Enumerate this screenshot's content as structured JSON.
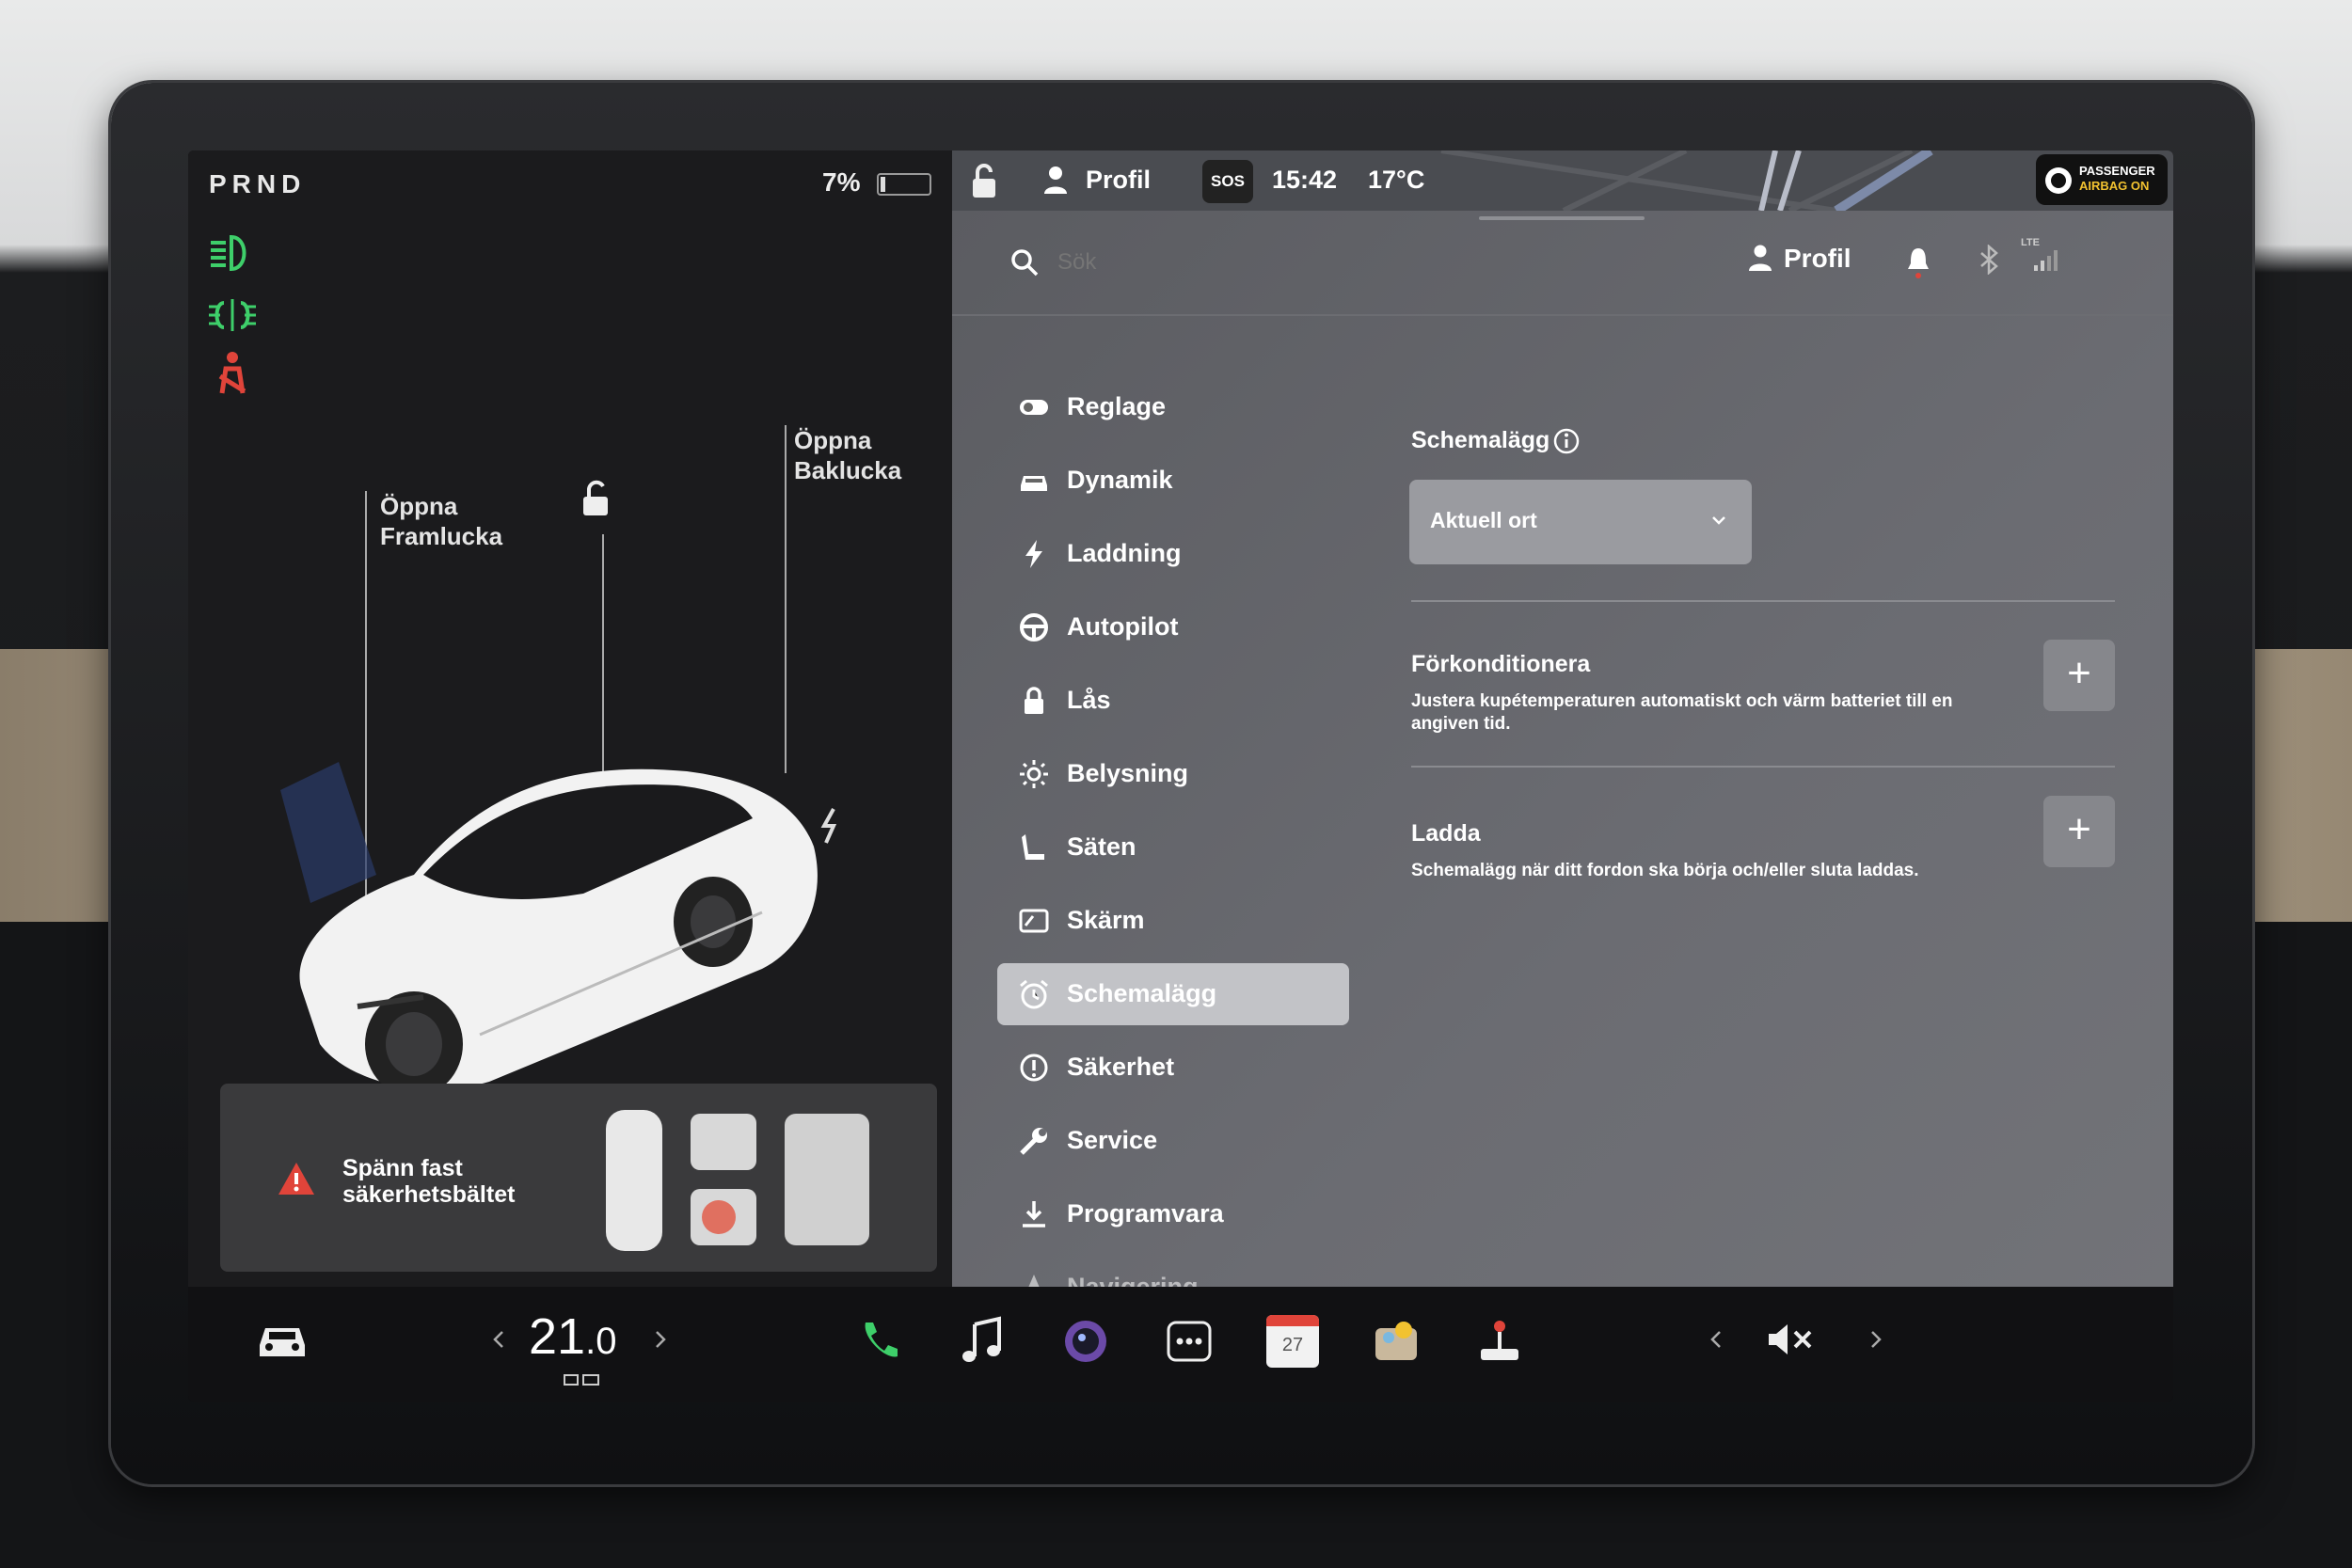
{
  "status": {
    "gear": "PRND",
    "battery": "7%",
    "time": "15:42",
    "temperature": "17°C",
    "profile": "Profil",
    "sos": "SOS",
    "airbag_line1": "PASSENGER",
    "airbag_line2": "AIRBAG ON"
  },
  "car": {
    "front_trunk_line1": "Öppna",
    "front_trunk_line2": "Framlucka",
    "rear_trunk_line1": "Öppna",
    "rear_trunk_line2": "Baklucka",
    "warning_line1": "Spänn fast",
    "warning_line2": "säkerhetsbältet"
  },
  "search": {
    "placeholder": "Sök",
    "profile": "Profil",
    "network": "LTE"
  },
  "nav": {
    "items": [
      {
        "label": "Reglage",
        "icon": "toggle-icon"
      },
      {
        "label": "Dynamik",
        "icon": "car-icon"
      },
      {
        "label": "Laddning",
        "icon": "bolt-icon"
      },
      {
        "label": "Autopilot",
        "icon": "steering-wheel-icon"
      },
      {
        "label": "Lås",
        "icon": "lock-icon"
      },
      {
        "label": "Belysning",
        "icon": "sun-icon"
      },
      {
        "label": "Säten",
        "icon": "seat-icon"
      },
      {
        "label": "Skärm",
        "icon": "display-icon"
      },
      {
        "label": "Schemalägg",
        "icon": "alarm-clock-icon"
      },
      {
        "label": "Säkerhet",
        "icon": "info-circle-icon"
      },
      {
        "label": "Service",
        "icon": "wrench-icon"
      },
      {
        "label": "Programvara",
        "icon": "download-icon"
      },
      {
        "label": "Navigering",
        "icon": "navigation-arrow-icon"
      }
    ],
    "active": "Schemalägg"
  },
  "schedule": {
    "title": "Schemalägg",
    "location": "Aktuell ort",
    "precondition_title": "Förkonditionera",
    "precondition_desc_line1": "Justera kupétemperaturen automatiskt och värm batteriet till en",
    "precondition_desc_line2": "angiven tid.",
    "charge_title": "Ladda",
    "charge_desc": "Schemalägg när ditt fordon ska börja och/eller sluta laddas."
  },
  "dock": {
    "temp_whole": "21",
    "temp_decimal": ".0",
    "calendar_day": "27"
  },
  "colors": {
    "accent_green": "#3ecf6a",
    "warning_red": "#e0443a",
    "active_nav": "#c2c3c7"
  }
}
